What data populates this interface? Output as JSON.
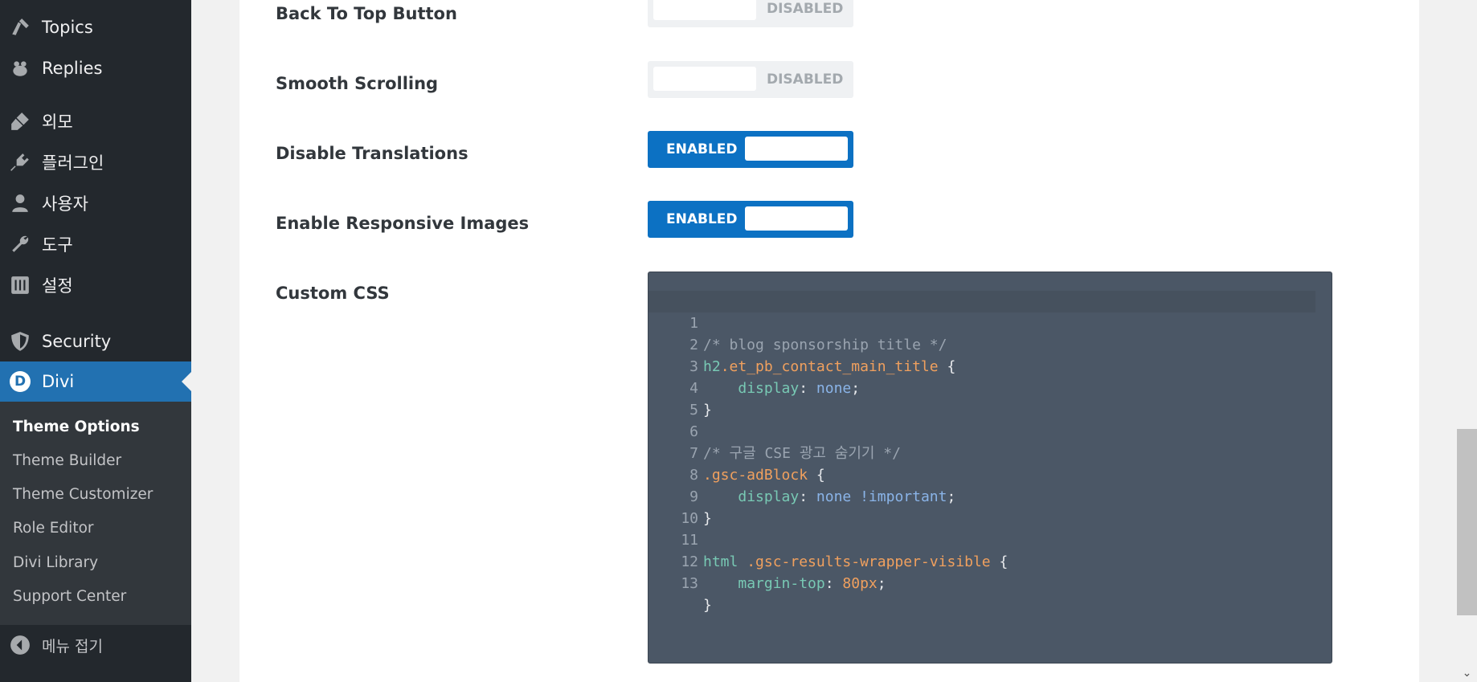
{
  "sidebar": {
    "items": [
      {
        "label": "Topics",
        "icon": "topics-icon"
      },
      {
        "label": "Replies",
        "icon": "replies-icon"
      },
      {
        "label": "외모",
        "icon": "appearance-brush-icon"
      },
      {
        "label": "플러그인",
        "icon": "plugin-icon"
      },
      {
        "label": "사용자",
        "icon": "user-icon"
      },
      {
        "label": "도구",
        "icon": "wrench-icon"
      },
      {
        "label": "설정",
        "icon": "settings-sliders-icon"
      },
      {
        "label": "Security",
        "icon": "shield-icon"
      },
      {
        "label": "Divi",
        "icon": "divi-logo-icon",
        "badge": "D"
      }
    ],
    "submenu": [
      {
        "label": "Theme Options",
        "current": true
      },
      {
        "label": "Theme Builder"
      },
      {
        "label": "Theme Customizer"
      },
      {
        "label": "Role Editor"
      },
      {
        "label": "Divi Library"
      },
      {
        "label": "Support Center"
      }
    ],
    "collapse_label": "메뉴 접기",
    "active_color": "#2271b1"
  },
  "options": {
    "back_to_top": {
      "label": "Back To Top Button",
      "state": "DISABLED"
    },
    "smooth_scrolling": {
      "label": "Smooth Scrolling",
      "state": "DISABLED"
    },
    "disable_translations": {
      "label": "Disable Translations",
      "state": "ENABLED"
    },
    "responsive_images": {
      "label": "Enable Responsive Images",
      "state": "ENABLED"
    },
    "custom_css": {
      "label": "Custom CSS"
    }
  },
  "code": {
    "line_numbers": [
      "1",
      "2",
      "3",
      "4",
      "5",
      "6",
      "7",
      "8",
      "9",
      "10",
      "11",
      "12",
      "13"
    ],
    "lines": {
      "l1": "/* blog sponsorship title */",
      "l2_sel": "h2",
      "l2_cls": ".et_pb_contact_main_title",
      "l2_brace": " {",
      "l3_prop": "display",
      "l3_colon": ": ",
      "l3_val": "none",
      "l3_semi": ";",
      "l4": "}",
      "l6": "/* 구글 CSE 광고 숨기기 */",
      "l7_cls": ".gsc-adBlock",
      "l7_brace": " {",
      "l8_prop": "display",
      "l8_colon": ": ",
      "l8_val": "none !important",
      "l8_semi": ";",
      "l9": "}",
      "l11_sel": "html",
      "l11_cls": " .gsc-results-wrapper-visible",
      "l11_brace": " {",
      "l12_prop": "margin-top",
      "l12_colon": ": ",
      "l12_val": "80px",
      "l12_semi": ";",
      "l13": "}"
    }
  },
  "colors": {
    "toggle_enabled": "#0c71c3",
    "toggle_disabled": "#eff1f3",
    "editor_bg": "#4b5766"
  }
}
